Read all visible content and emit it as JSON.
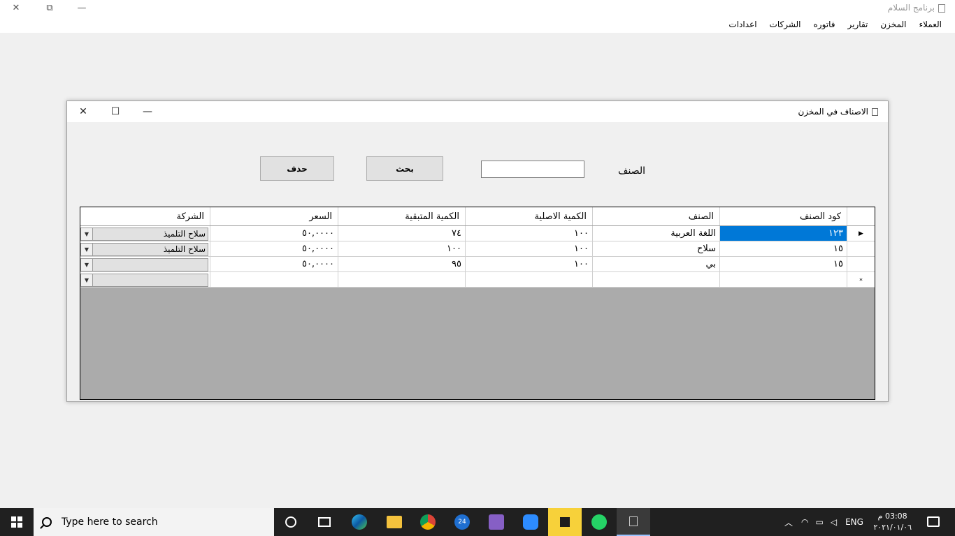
{
  "app": {
    "title": "برنامج السلام",
    "minimize": "—",
    "restore": "⧉",
    "close": "✕"
  },
  "menu": [
    "العملاء",
    "المخزن",
    "تقارير",
    "فاتوره",
    "الشركات",
    "اعدادات"
  ],
  "form": {
    "title": "الاصناف في المخزن",
    "minimize": "—",
    "maximize": "☐",
    "close": "✕",
    "item_label": "الصنف",
    "search_value": "",
    "search_button": "بحث",
    "delete_button": "حذف"
  },
  "grid": {
    "columns": [
      "كود الصنف",
      "الصنف",
      "الكمية الاصلية",
      "الكمية المتبقية",
      "السعر",
      "الشركة"
    ],
    "rows": [
      {
        "marker": "▶",
        "code": "١٢٣",
        "name": "اللغة العربية",
        "qty_orig": "١٠٠",
        "qty_left": "٧٤",
        "price": "٥٠,٠٠٠٠",
        "company": "سلاح التلميذ"
      },
      {
        "marker": "",
        "code": "١٥",
        "name": "سلاح",
        "qty_orig": "١٠٠",
        "qty_left": "١٠٠",
        "price": "٥٠,٠٠٠٠",
        "company": "سلاح التلميذ"
      },
      {
        "marker": "",
        "code": "١٥",
        "name": "بي",
        "qty_orig": "١٠٠",
        "qty_left": "٩٥",
        "price": "٥٠,٠٠٠٠",
        "company": ""
      },
      {
        "marker": "*",
        "code": "",
        "name": "",
        "qty_orig": "",
        "qty_left": "",
        "price": "",
        "company": ""
      }
    ],
    "selected_color": "#0078d7"
  },
  "taskbar": {
    "search_placeholder": "Type here to search",
    "language": "ENG",
    "time": "03:08 م",
    "date": "٢٠٢١/٠١/٠٦",
    "edge_badge": "24"
  }
}
